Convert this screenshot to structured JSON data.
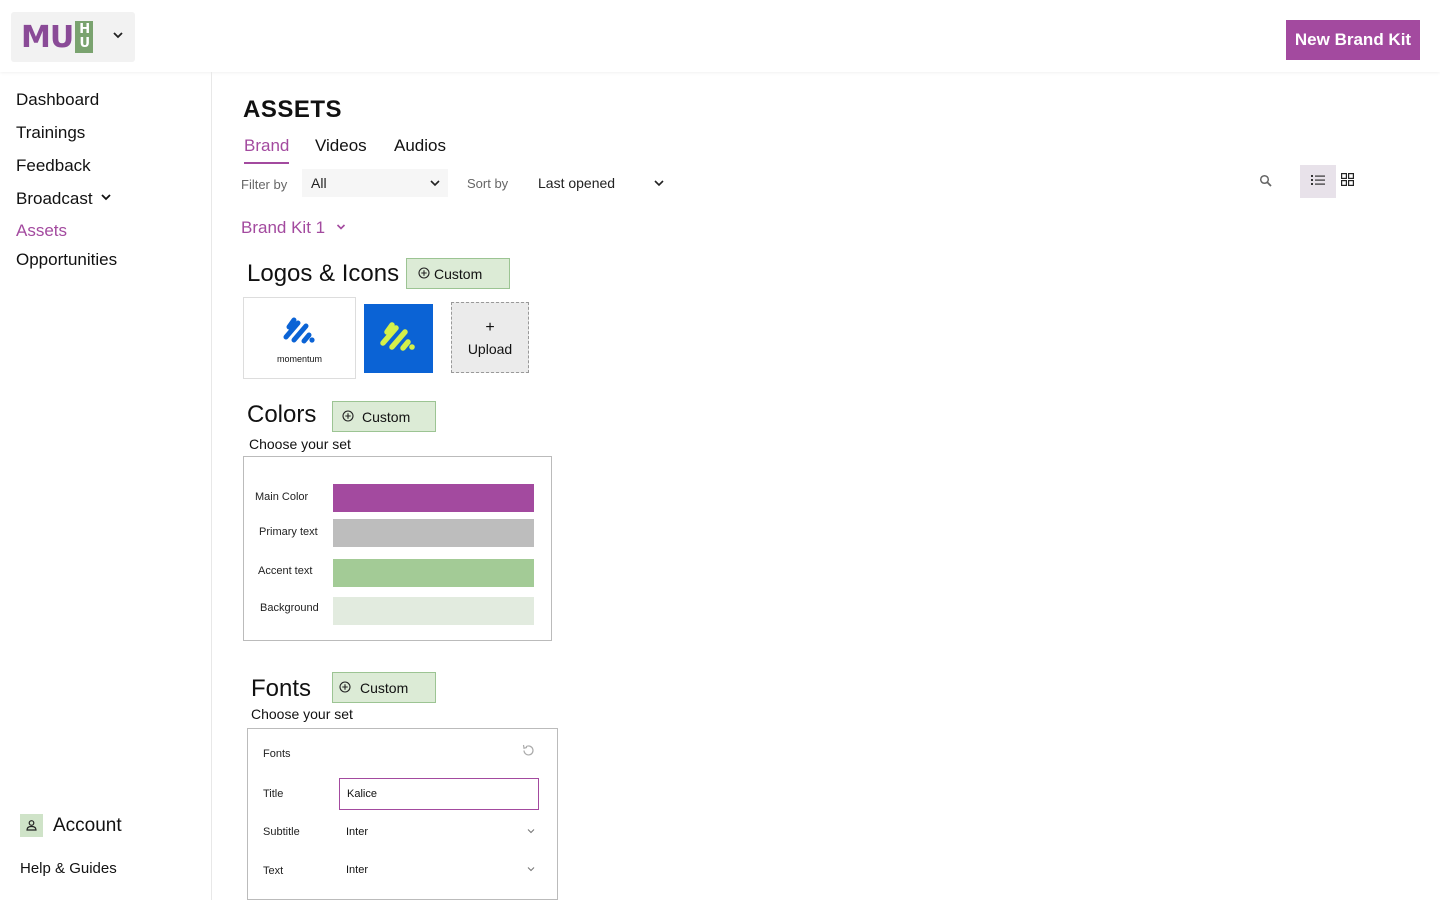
{
  "app": {
    "logo_text": "MU",
    "logo_sub_top": "H",
    "logo_sub_bottom": "U",
    "new_kit_label": "New Brand Kit"
  },
  "sidebar": {
    "items": [
      {
        "label": "Dashboard"
      },
      {
        "label": "Trainings"
      },
      {
        "label": "Feedback"
      },
      {
        "label": "Broadcast"
      },
      {
        "label": "Assets"
      },
      {
        "label": "Opportunities"
      }
    ],
    "account_label": "Account",
    "help_label": "Help & Guides"
  },
  "main": {
    "title": "ASSETS",
    "tabs": [
      {
        "label": "Brand"
      },
      {
        "label": "Videos"
      },
      {
        "label": "Audios"
      }
    ],
    "filter_label": "Filter by",
    "filter_value": "All",
    "sort_label": "Sort by",
    "sort_value": "Last opened",
    "kit_selector": "Brand Kit 1"
  },
  "logos": {
    "heading": "Logos & Icons",
    "custom_label": "Custom",
    "logo1_caption": "momentum",
    "upload_plus": "+",
    "upload_label": "Upload"
  },
  "colors": {
    "heading": "Colors",
    "custom_label": "Custom",
    "choose_label": "Choose your set",
    "rows": [
      {
        "label": "Main Color",
        "color": "#a34a9f"
      },
      {
        "label": "Primary text",
        "color": "#bdbdbd"
      },
      {
        "label": "Accent text",
        "color": "#a3cb96"
      },
      {
        "label": "Background",
        "color": "#e2ebdf"
      }
    ]
  },
  "fonts": {
    "heading": "Fonts",
    "custom_label": "Custom",
    "choose_label": "Choose your set",
    "box_title": "Fonts",
    "title_label": "Title",
    "title_value": "Kalice",
    "subtitle_label": "Subtitle",
    "subtitle_value": "Inter",
    "text_label": "Text",
    "text_value": "Inter"
  },
  "icons": {
    "chevron": "chevron-down-icon",
    "search": "search-icon",
    "list_view": "list-view-icon",
    "grid_view": "grid-view-icon",
    "account": "person-icon",
    "add": "plus-circle-icon",
    "reset": "refresh-icon"
  },
  "theme": {
    "accent": "#a34a9f",
    "green_light": "#dcebd6",
    "green_border": "#9cc493",
    "logo_blue": "#0b63d5",
    "logo_yellow_green": "#d4f04a"
  }
}
